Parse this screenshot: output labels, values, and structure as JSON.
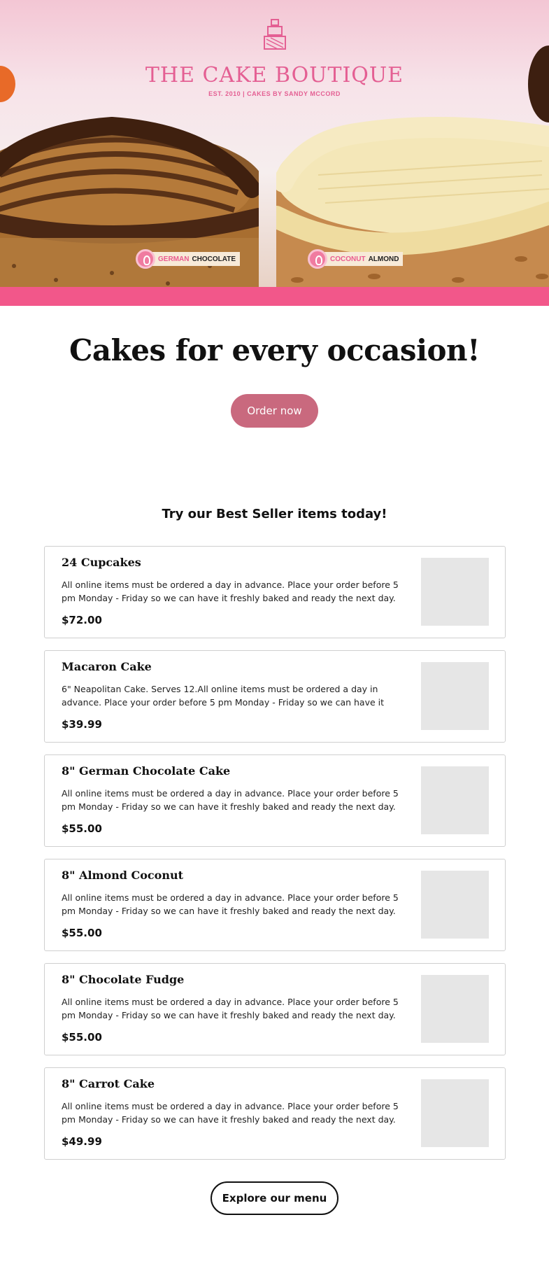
{
  "hero": {
    "brand_name": "THE CAKE BOUTIQUE",
    "brand_tagline": "EST. 2010  |  CAKES BY SANDY MCCORD",
    "left_tag": {
      "accent": "GERMAN",
      "rest": "CHOCOLATE"
    },
    "right_tag": {
      "accent": "COCONUT",
      "rest": "ALMOND"
    },
    "colors": {
      "brand_pink": "#e45f93",
      "bar_pink": "#f2578a"
    }
  },
  "main": {
    "headline": "Cakes for every occasion!",
    "order_button": "Order now",
    "best_seller_heading": "Try our Best Seller items today!",
    "explore_button": "Explore our menu"
  },
  "items": [
    {
      "name": "24 Cupcakes",
      "description": "All online items must be ordered a day in advance. Place your order before 5 pm Monday - Friday so we can have it freshly baked and ready the next day. For...",
      "price": "$72.00"
    },
    {
      "name": "Macaron Cake",
      "description": "6\" Neapolitan Cake. Serves 12.All online items must be ordered a day in advance. Place your order before 5 pm Monday - Friday so we can have it freshl...",
      "price": "$39.99"
    },
    {
      "name": "8\" German Chocolate Cake",
      "description": "All online items must be ordered a day in advance. Place your order before 5 pm Monday - Friday so we can have it freshly baked and ready the next day. For...",
      "price": "$55.00"
    },
    {
      "name": "8\" Almond Coconut",
      "description": "All online items must be ordered a day in advance. Place your order before 5 pm Monday - Friday so we can have it freshly baked and ready the next day. For...",
      "price": "$55.00"
    },
    {
      "name": "8\" Chocolate Fudge",
      "description": "All online items must be ordered a day in advance. Place your order before 5 pm Monday - Friday so we can have it freshly baked and ready the next day. For...",
      "price": "$55.00"
    },
    {
      "name": "8\" Carrot Cake",
      "description": "All online items must be ordered a day in advance. Place your order before 5 pm Monday - Friday so we can have it freshly baked and ready the next day. For...",
      "price": "$49.99"
    }
  ]
}
